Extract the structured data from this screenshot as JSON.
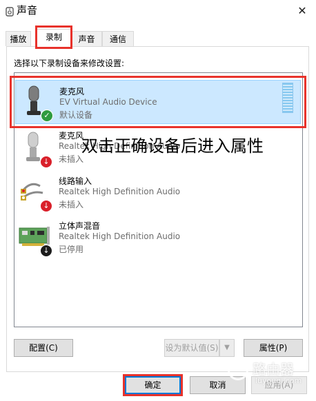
{
  "window": {
    "title": "声音",
    "close_glyph": "✕"
  },
  "tabs": [
    {
      "label": "播放"
    },
    {
      "label": "录制"
    },
    {
      "label": "声音"
    },
    {
      "label": "通信"
    }
  ],
  "instruction": "选择以下录制设备来修改设置:",
  "devices": [
    {
      "name": "麦克风",
      "desc": "EV Virtual Audio Device",
      "status": "默认设备",
      "icon": "microphone-icon",
      "badge": "check-badge-icon"
    },
    {
      "name": "麦克风",
      "desc": "Realtek High Definition Audio",
      "status": "未插入",
      "icon": "microphone-icon",
      "badge": "down-arrow-badge-icon"
    },
    {
      "name": "线路输入",
      "desc": "Realtek High Definition Audio",
      "status": "未插入",
      "icon": "line-in-icon",
      "badge": "down-arrow-badge-icon"
    },
    {
      "name": "立体声混音",
      "desc": "Realtek High Definition Audio",
      "status": "已停用",
      "icon": "sound-card-icon",
      "badge": "down-arrow-black-badge-icon"
    }
  ],
  "annotation": "双击正确设备后进入属性",
  "buttons": {
    "configure": "配置(C)",
    "set_default": "设为默认值(S)",
    "properties": "属性(P)",
    "ok": "确定",
    "cancel": "取消",
    "apply": "应用(A)"
  },
  "watermark": {
    "title": "路由器",
    "subtitle": "luyouqi.com"
  },
  "colors": {
    "highlight": "#e8322b",
    "selection": "#cce8ff",
    "accent": "#0078d7"
  }
}
